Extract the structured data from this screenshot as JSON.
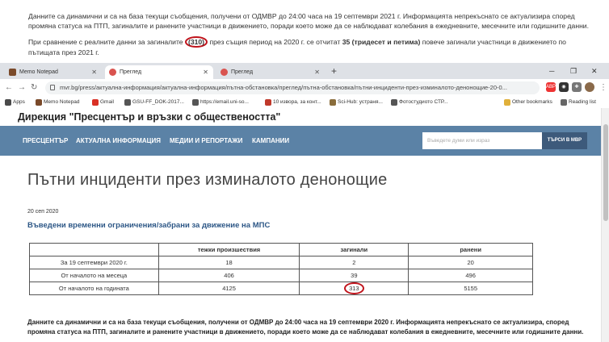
{
  "top_snippet": {
    "para1": "Данните са динамични и са на база текущи съобщения, получени от ОДМВР до 24:00 часа на 19 септември 2021 г. Информацията непрекъснато се актуализира според промяна статуса на ПТП, загиналите и ранените участници в движението, поради което може да се наблюдават колебания в ежедневните, месечните или годишните данни.",
    "para2_start": "При сравнение с реалните данни за загиналите",
    "para2_circled": "(310)",
    "para2_mid": "през същия период на 2020 г. се отчитат",
    "para2_bold": "35 (тридесет и петима)",
    "para2_end": "повече загинали участници в движението по пътищата през 2021 г."
  },
  "browser": {
    "tabs": [
      {
        "label": "Memo Notepad",
        "color": "#7a4a2a",
        "active": false
      },
      {
        "label": "Преглед",
        "color": "#d9534f",
        "active": true
      },
      {
        "label": "Преглед",
        "color": "#d9534f",
        "active": false
      }
    ],
    "new_tab": "+",
    "url": "mvr.bg/press/актуална-информация/актуална-информация/пътна-обстановка/преглед/пътна-обстановка/пътни-инциденти-през-изминалото-денонощие-20-0...",
    "bookmarks": [
      {
        "label": "Apps",
        "color": "#4a4a4a"
      },
      {
        "label": "Memo Notepad",
        "color": "#7a4a2a"
      },
      {
        "label": "Gmail",
        "color": "#d93025"
      },
      {
        "label": "GSU-FF_DOK-2017...",
        "color": "#555"
      },
      {
        "label": "https://email.uni-so...",
        "color": "#555"
      },
      {
        "label": "10 извора, за конт...",
        "color": "#c0392b"
      },
      {
        "label": "Sci-Hub: устраня...",
        "color": "#8a6d3b"
      },
      {
        "label": "Фотостудиото СТР...",
        "color": "#555"
      }
    ],
    "other_bookmarks": "Other bookmarks",
    "reading_list": "Reading list"
  },
  "site": {
    "header": "Дирекция \"Пресцентър и връзки с обществеността\"",
    "nav": [
      "ПРЕСЦЕНТЪР",
      "АКТУАЛНА ИНФОРМАЦИЯ",
      "МЕДИИ И РЕПОРТАЖИ",
      "КАМПАНИИ"
    ],
    "search_placeholder": "Въведете думи или израз",
    "search_button": "ТЪРСИ В МВР",
    "title": "Пътни инциденти през изминалото денонощие",
    "date": "20 сеп 2020",
    "subtitle": "Въведени временни ограничения/забрани за движение на МПС",
    "table": {
      "headers": [
        "",
        "тежки произшествия",
        "загинали",
        "ранени"
      ],
      "rows": [
        [
          "За 19 септември 2020 г.",
          "18",
          "2",
          "20"
        ],
        [
          "От началото на месеца",
          "406",
          "39",
          "496"
        ],
        [
          "От началото на годината",
          "4125",
          "313",
          "5155"
        ]
      ]
    },
    "bottom_text": "Данните са динамични и са на база текущи съобщения, получени от ОДМВР до 24:00 часа на 19 септември 2020 г. Информацията непрекъснато се актуализира, според промяна статуса на ПТП, загиналите и ранените участници в движението, поради което може да се наблюдават колебания в ежедневните, месечните или годишните данни."
  },
  "colors": {
    "nav_bg": "#5b82a6",
    "highlight_circle": "#c0141c",
    "subtitle": "#2d5786"
  }
}
